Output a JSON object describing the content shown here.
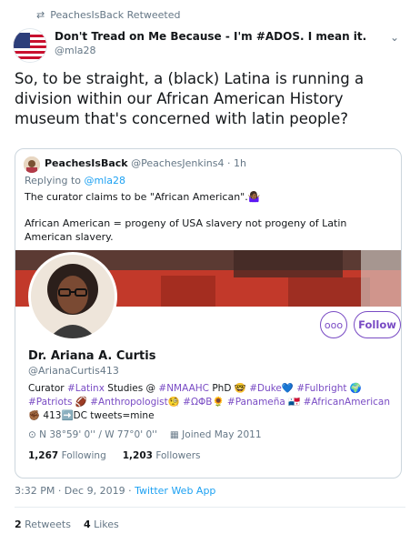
{
  "retweet": {
    "label": "PeachesIsBack Retweeted"
  },
  "author": {
    "name": "Don't Tread on Me Because - I'm #ADOS. I mean it.",
    "handle": "@mla28"
  },
  "tweet": {
    "text": "So, to be straight, a (black) Latina is running a division within our African American History museum that's concerned with latin people?"
  },
  "quote": {
    "author_name": "PeachesIsBack",
    "author_handle": "@PeachesJenkins4",
    "time": "· 1h",
    "reply_prefix": "Replying to ",
    "reply_to": "@mla28",
    "line1": "The curator claims to be \"African American\".",
    "line1_emoji": "🤷🏾‍♀️",
    "line2": "African American = progeny of USA slavery not progeny of Latin American slavery."
  },
  "profile": {
    "name": "Dr. Ariana A. Curtis",
    "handle": "@ArianaCurtis413",
    "more_label": "ooo",
    "follow_label": "Follow",
    "bio": {
      "t1": "Curator ",
      "h1": "#Latinx",
      "t2": " Studies @ ",
      "h2": "#NMAAHC",
      "t3": " PhD 🤓 ",
      "h3": "#Duke",
      "t4": "💙 ",
      "h4": "#Fulbright",
      "t5": " 🌍 ",
      "h5": "#Patriots",
      "t6": " 🏈 ",
      "h6": "#Anthropologist",
      "t7": "🧐 ",
      "h7": "#ΩΦΒ",
      "t8": "🌻 ",
      "h8": "#Panameña",
      "t9": " 🇵🇦 ",
      "h9": "#AfricanAmerican",
      "t10": "✊🏾 413➡️DC tweets=mine"
    },
    "location": "N 38°59' 0'' / W 77°0' 0''",
    "joined": "Joined May 2011",
    "following_count": "1,267",
    "following_label": "Following",
    "followers_count": "1,203",
    "followers_label": "Followers"
  },
  "timestamp": {
    "time": "3:32 PM · Dec 9, 2019 · ",
    "source": "Twitter Web App"
  },
  "engagement": {
    "retweets_count": "2",
    "retweets_label": "Retweets",
    "likes_count": "4",
    "likes_label": "Likes"
  },
  "icons": {
    "retweet": "retweet-icon",
    "chevron": "chevron-down-icon",
    "location": "location-pin-icon",
    "calendar": "calendar-icon"
  },
  "colors": {
    "accent_link": "#1da1f2",
    "hashtag": "#794bc4",
    "muted": "#657786"
  }
}
